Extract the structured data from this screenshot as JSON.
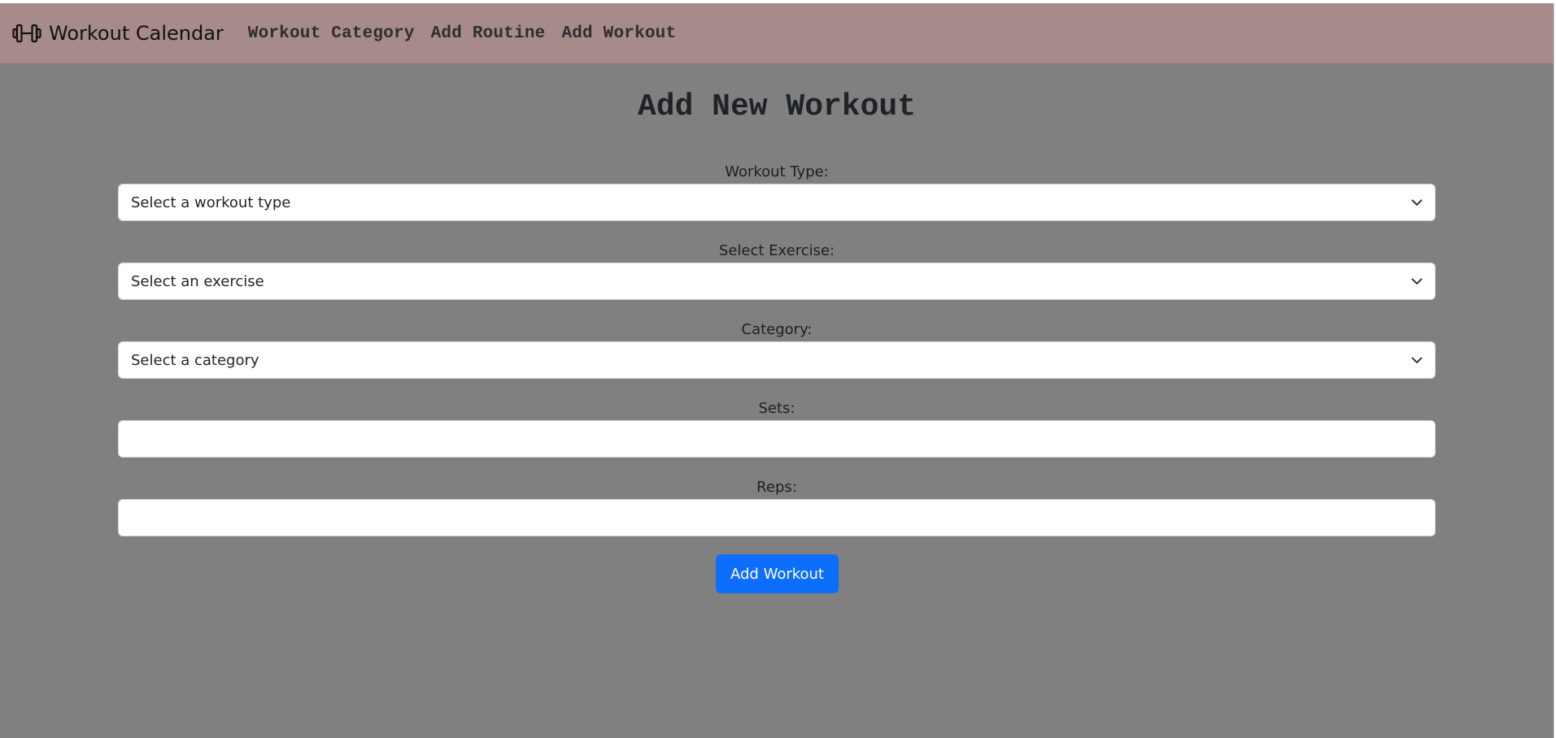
{
  "navbar": {
    "brand_label": "Workout Calendar",
    "brand_icon": "dumbbell-icon",
    "links": [
      {
        "label": "Workout Category"
      },
      {
        "label": "Add Routine"
      },
      {
        "label": "Add Workout"
      }
    ]
  },
  "page": {
    "title": "Add New Workout"
  },
  "form": {
    "workout_type": {
      "label": "Workout Type:",
      "value": "Select a workout type"
    },
    "exercise": {
      "label": "Select Exercise:",
      "value": "Select an exercise"
    },
    "category": {
      "label": "Category:",
      "value": "Select a category"
    },
    "sets": {
      "label": "Sets:",
      "value": ""
    },
    "reps": {
      "label": "Reps:",
      "value": ""
    },
    "submit_label": "Add Workout"
  },
  "colors": {
    "navbar_bg": "#a78a8a",
    "page_bg": "#808080",
    "primary_button": "#0d6efd"
  }
}
